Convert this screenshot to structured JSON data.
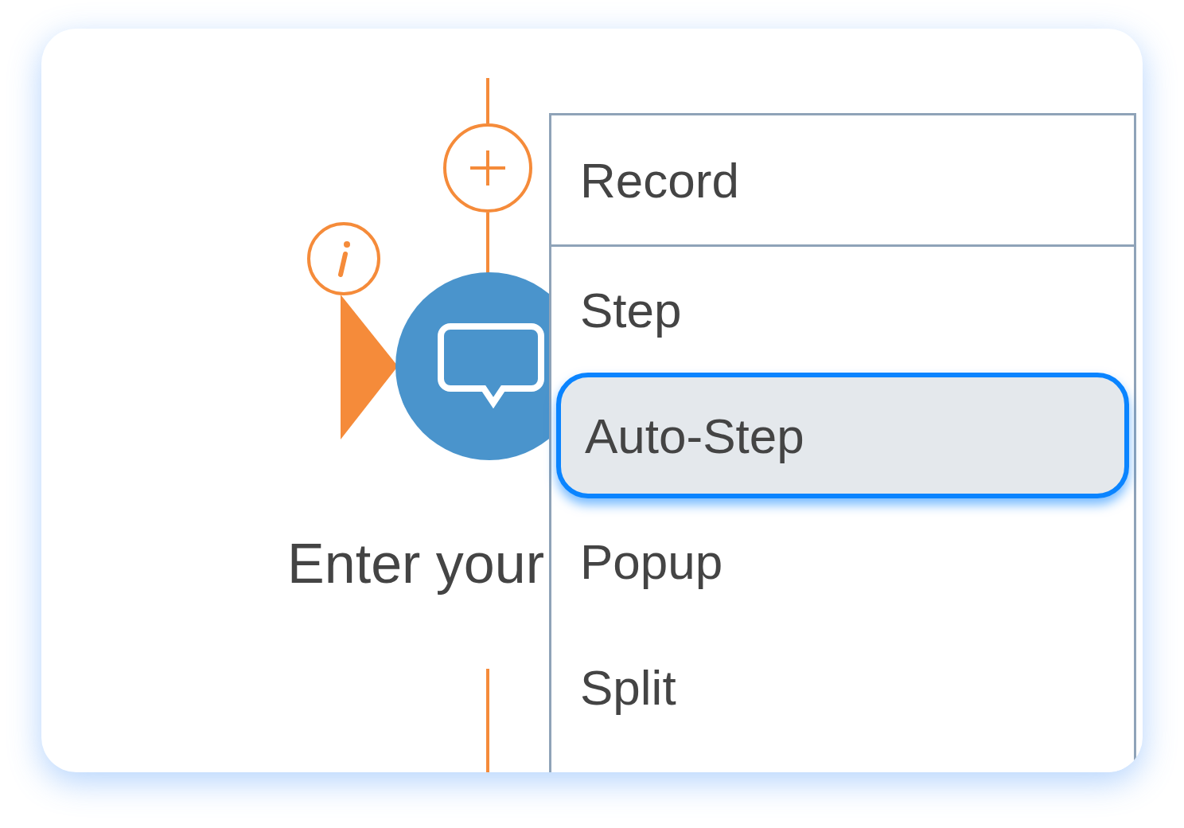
{
  "node": {
    "label": "Enter your"
  },
  "menu": {
    "items": [
      {
        "label": "Record",
        "kind": "header",
        "selected": false
      },
      {
        "label": "Step",
        "kind": "option",
        "selected": false
      },
      {
        "label": "Auto-Step",
        "kind": "option",
        "selected": true
      },
      {
        "label": "Popup",
        "kind": "option",
        "selected": false
      },
      {
        "label": "Split",
        "kind": "option",
        "selected": false
      }
    ]
  }
}
